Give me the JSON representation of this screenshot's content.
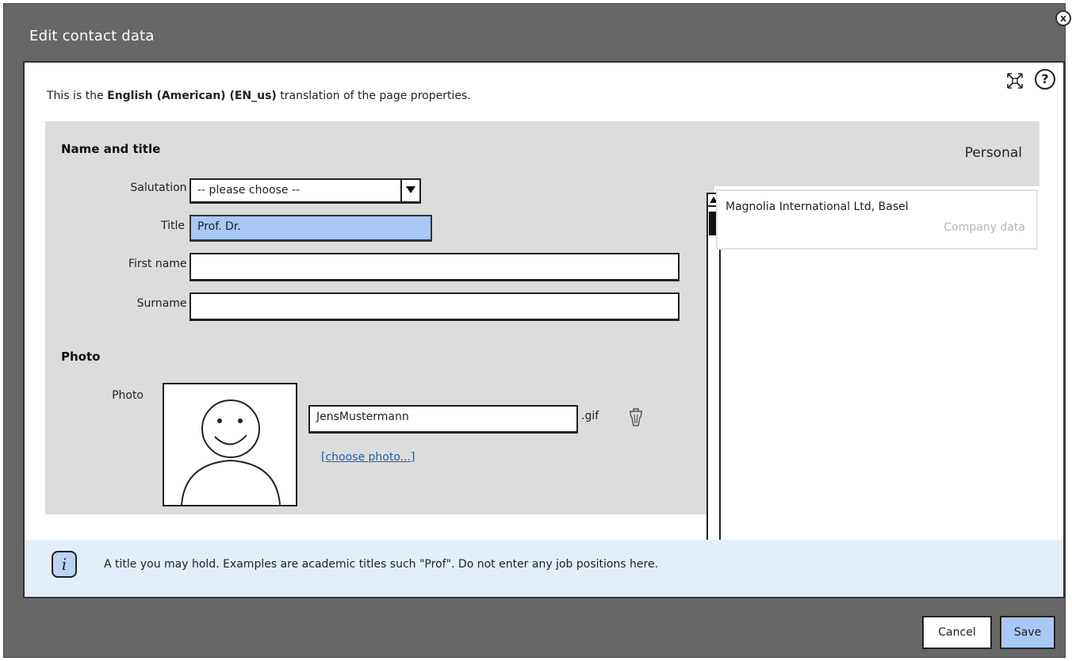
{
  "dialog": {
    "title": "Edit contact data",
    "close_label": "x",
    "help_label": "?"
  },
  "intro": {
    "prefix": "This is the ",
    "language": "English (American) (EN_us)",
    "suffix": " translation of the page properties."
  },
  "form": {
    "name_section_title": "Name and title",
    "salutation": {
      "label": "Salutation *",
      "value": "-- please choose --"
    },
    "title": {
      "label": "Title",
      "value": "Prof. Dr."
    },
    "first_name": {
      "label": "First name *",
      "value": ""
    },
    "surname": {
      "label": "Surname *",
      "value": ""
    },
    "photo_section_title": "Photo",
    "photo": {
      "label": "Photo",
      "filename": "JensMustermann",
      "extension": ".gif",
      "choose_link": "[choose photo...]",
      "delete_icon": "trash-icon"
    }
  },
  "side_tabs": [
    {
      "label": "Personal",
      "active": true
    },
    {
      "label": "Magnolia International Ltd, Basel",
      "sublabel": "Company data",
      "active": false
    }
  ],
  "info": {
    "icon_label": "i",
    "text": "A title you may hold. Examples are academic titles such \"Prof\". Do not enter any job positions here."
  },
  "buttons": {
    "cancel": "Cancel",
    "save": "Save"
  },
  "colors": {
    "dialog_bg": "#676767",
    "selected_field": "#a8c8f6",
    "form_bg": "#dcdcdc",
    "info_bg": "#e3eefb",
    "link": "#1d5fb0"
  }
}
